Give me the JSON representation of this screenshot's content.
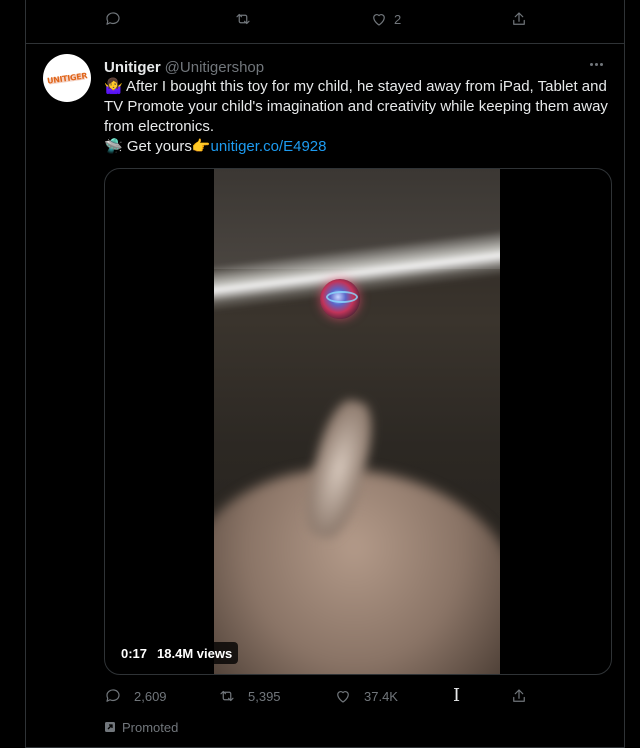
{
  "top_actions": {
    "reply_count": "",
    "retweet_count": "",
    "like_count": "2"
  },
  "tweet": {
    "name": "Unitiger",
    "handle": "@Unitigershop",
    "avatar_text": "UNITIGER",
    "body_line1": "🤷‍♀️ After I bought this toy for my child, he stayed away from iPad, Tablet and TV Promote your child's imagination and creativity while keeping them away from electronics.",
    "body_line2_prefix": "🛸 Get yours👉",
    "link": "unitiger.co/E4928",
    "video": {
      "duration": "0:17",
      "views": "18.4M views"
    },
    "replies": "2,609",
    "retweets": "5,395",
    "likes": "37.4K",
    "promoted_label": "Promoted"
  },
  "colors": {
    "accent": "#1d9bf0",
    "muted": "#71767b",
    "text": "#e7e9ea",
    "border": "#2f3336"
  }
}
